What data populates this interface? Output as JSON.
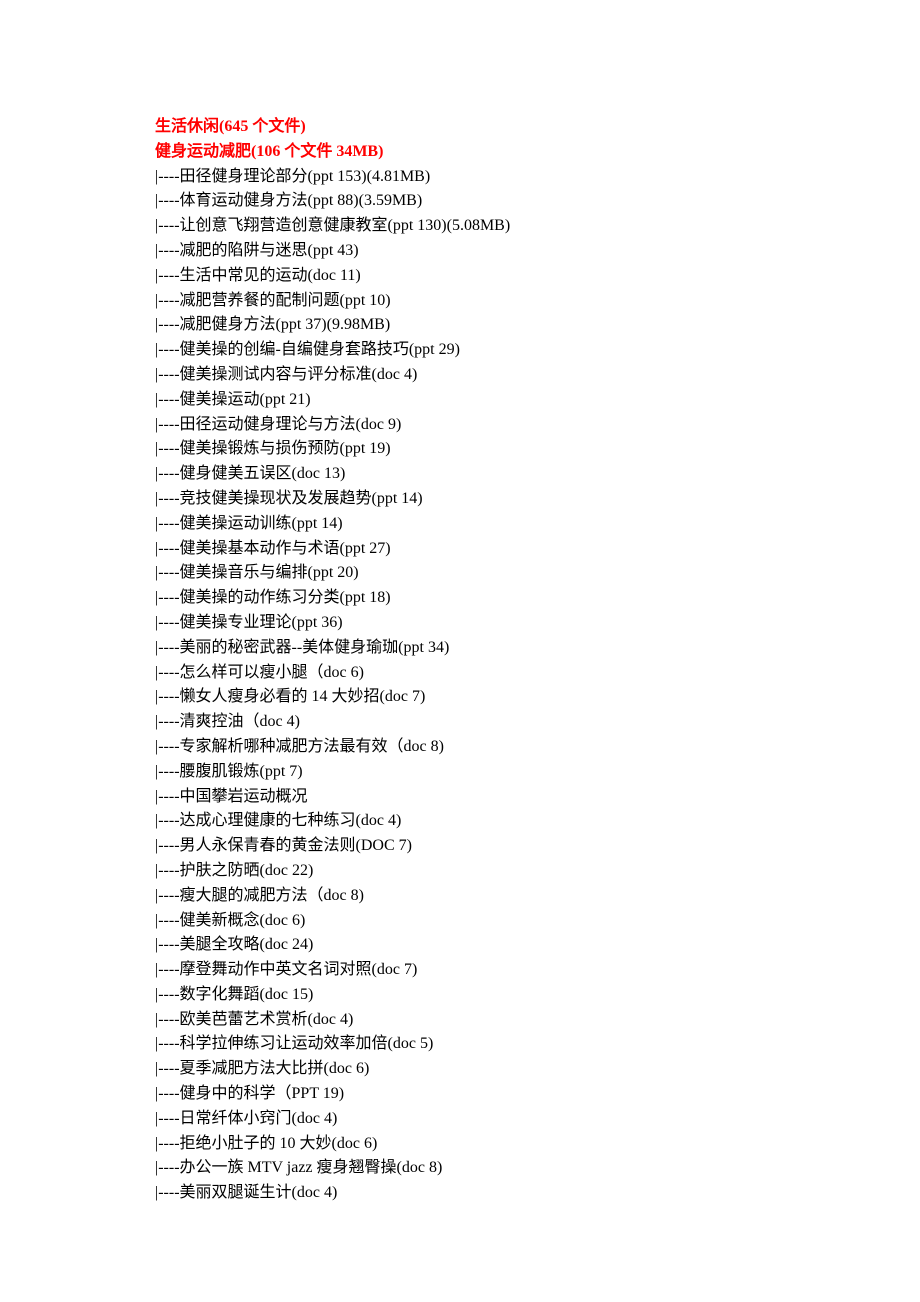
{
  "heading1": "生活休闲(645 个文件)",
  "heading2": "健身运动减肥(106 个文件  34MB)",
  "items": [
    "|----田径健身理论部分(ppt 153)(4.81MB)",
    "|----体育运动健身方法(ppt 88)(3.59MB)",
    "|----让创意飞翔营造创意健康教室(ppt 130)(5.08MB)",
    "|----减肥的陷阱与迷思(ppt 43)",
    "|----生活中常见的运动(doc 11)",
    "|----减肥营养餐的配制问题(ppt 10)",
    "|----减肥健身方法(ppt 37)(9.98MB)",
    "|----健美操的创编-自编健身套路技巧(ppt 29)",
    "|----健美操测试内容与评分标准(doc 4)",
    "|----健美操运动(ppt 21)",
    "|----田径运动健身理论与方法(doc 9)",
    "|----健美操锻炼与损伤预防(ppt 19)",
    "|----健身健美五误区(doc 13)",
    "|----竞技健美操现状及发展趋势(ppt 14)",
    "|----健美操运动训练(ppt 14)",
    "|----健美操基本动作与术语(ppt 27)",
    "|----健美操音乐与编排(ppt 20)",
    "|----健美操的动作练习分类(ppt 18)",
    "|----健美操专业理论(ppt 36)",
    "|----美丽的秘密武器--美体健身瑜珈(ppt 34)",
    "|----怎么样可以瘦小腿（doc 6)",
    "|----懒女人瘦身必看的 14 大妙招(doc 7)",
    "|----清爽控油（doc 4)",
    "|----专家解析哪种减肥方法最有效（doc 8)",
    "|----腰腹肌锻炼(ppt 7)",
    "|----中国攀岩运动概况",
    "|----达成心理健康的七种练习(doc 4)",
    "|----男人永保青春的黄金法则(DOC 7)",
    "|----护肤之防晒(doc 22)",
    "|----瘦大腿的减肥方法（doc 8)",
    "|----健美新概念(doc 6)",
    "|----美腿全攻略(doc 24)",
    "|----摩登舞动作中英文名词对照(doc 7)",
    "|----数字化舞蹈(doc 15)",
    "|----欧美芭蕾艺术赏析(doc 4)",
    "|----科学拉伸练习让运动效率加倍(doc 5)",
    "|----夏季减肥方法大比拼(doc 6)",
    "|----健身中的科学（PPT 19)",
    "|----日常纤体小窍门(doc 4)",
    "|----拒绝小肚子的 10 大妙(doc 6)",
    "|----办公一族 MTV jazz 瘦身翘臀操(doc 8)",
    "|----美丽双腿诞生计(doc 4)"
  ]
}
